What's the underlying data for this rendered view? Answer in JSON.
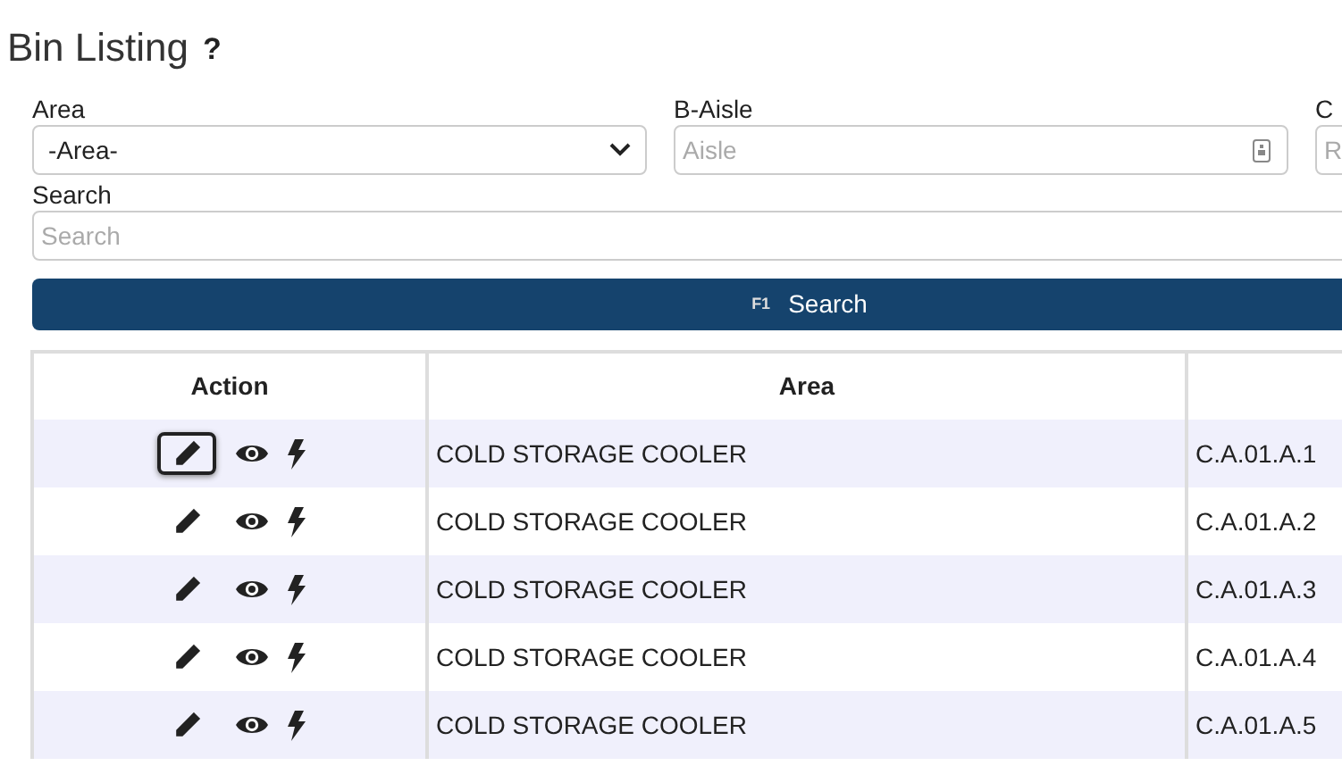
{
  "page_title": "Bin Listing",
  "help_mark": "?",
  "filters": [
    {
      "kind": "select",
      "label": "Area",
      "value": "-Area-"
    },
    {
      "kind": "input",
      "label": "B-Aisle",
      "placeholder": "Aisle"
    },
    {
      "kind": "input",
      "label": "C",
      "placeholder": "R"
    }
  ],
  "search": {
    "label": "Search",
    "placeholder": "Search"
  },
  "search_button": {
    "key": "F1",
    "label": "Search"
  },
  "table": {
    "columns": [
      "Action",
      "Area"
    ],
    "rows": [
      {
        "edit_focused": true,
        "area": "COLD STORAGE COOLER",
        "column_3": "C.A.01.A.1"
      },
      {
        "edit_focused": false,
        "area": "COLD STORAGE COOLER",
        "column_3": "C.A.01.A.2"
      },
      {
        "edit_focused": false,
        "area": "COLD STORAGE COOLER",
        "column_3": "C.A.01.A.3"
      },
      {
        "edit_focused": false,
        "area": "COLD STORAGE COOLER",
        "column_3": "C.A.01.A.4"
      },
      {
        "edit_focused": false,
        "area": "COLD STORAGE COOLER",
        "column_3": "C.A.01.A.5"
      }
    ]
  }
}
